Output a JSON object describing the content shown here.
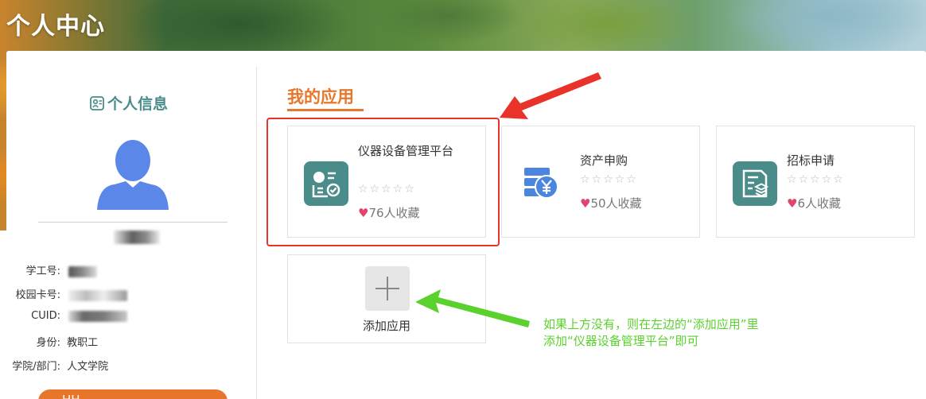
{
  "header": {
    "title": "个人中心"
  },
  "profile": {
    "section_title": "个人信息",
    "fields": [
      {
        "label": "学工号:",
        "value": ""
      },
      {
        "label": "校园卡号:",
        "value": ""
      },
      {
        "label": "CUID:",
        "value": ""
      },
      {
        "label": "身份:",
        "value": "教职工"
      },
      {
        "label": "学院/部门:",
        "value": "人文学院"
      }
    ],
    "button_label": "HH"
  },
  "apps_section": {
    "title": "我的应用",
    "apps": [
      {
        "name": "仪器设备管理平台",
        "stars": "☆☆☆☆☆",
        "favorites": "76人收藏",
        "icon": "instrument-card-icon",
        "icon_color": "#4a8c8a"
      },
      {
        "name": "资产申购",
        "stars": "☆☆☆☆☆",
        "favorites": "50人收藏",
        "icon": "yen-database-icon",
        "icon_color": "#4a86e0"
      },
      {
        "name": "招标申请",
        "stars": "☆☆☆☆☆",
        "favorites": "6人收藏",
        "icon": "document-layers-icon",
        "icon_color": "#4a8c8a"
      }
    ],
    "add_label": "添加应用"
  },
  "annotation": {
    "note_line1": "如果上方没有，则在左边的“添加应用”里",
    "note_line2": "添加“仪器设备管理平台”即可",
    "red_color": "#e8322a",
    "green_color": "#5bd12e"
  },
  "colors": {
    "accent": "#e8762a",
    "teal": "#4a8c8a",
    "heart": "#e0456d"
  }
}
